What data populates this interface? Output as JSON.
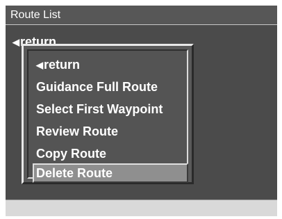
{
  "header": {
    "title": "Route List"
  },
  "background": {
    "return_label": "return",
    "return_icon": "left-triangle-icon"
  },
  "menu": {
    "items": [
      {
        "label": "return",
        "icon": "left-triangle-icon"
      },
      {
        "label": "Guidance Full Route"
      },
      {
        "label": "Select First Waypoint"
      },
      {
        "label": "Review Route"
      },
      {
        "label": "Copy Route"
      },
      {
        "label": "Delete Route",
        "selected": true
      }
    ]
  },
  "colors": {
    "screen_bg": "#4b4b4b",
    "menu_bg": "#545454",
    "selected_bg": "#8f8f8f",
    "text": "#ffffff",
    "footer_bg": "#d9d9d9"
  }
}
